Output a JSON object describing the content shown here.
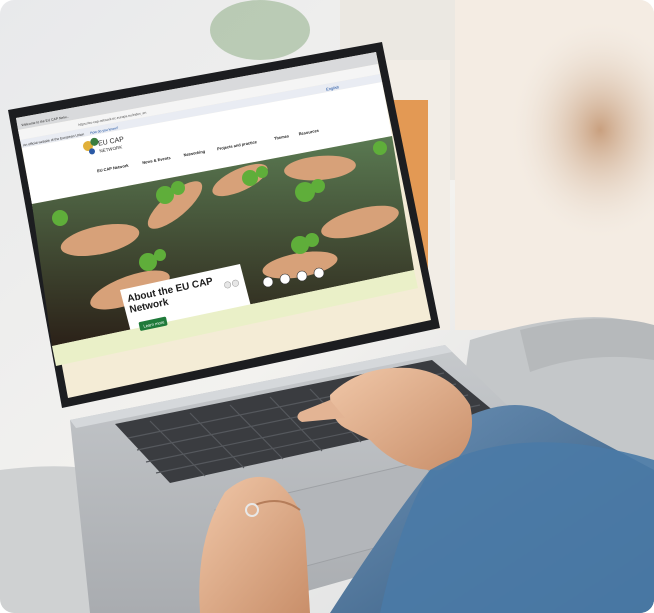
{
  "scene": {
    "subject": "person-typing-on-laptop",
    "setting": "living-room-sofa"
  },
  "browser": {
    "tab_title": "Welcome to the EU CAP Netw...",
    "url": "https://eu-cap-network.ec.europa.eu/index_en",
    "official_notice": "An official website of the European Union",
    "notice_link": "How do you know?",
    "language": "English"
  },
  "site": {
    "logo_text": [
      "EU CAP",
      "NETWORK"
    ],
    "nav": [
      "EU CAP Network",
      "News & Events",
      "Networking",
      "Projects and practice",
      "Themes",
      "Resources"
    ]
  },
  "hero": {
    "title_line1": "About the EU CAP",
    "title_line2": "Network",
    "button": "Learn more",
    "carousel_dots": 4
  },
  "colors": {
    "accent_green": "#1f7a3a",
    "page_beige": "#f4ecd6",
    "laptop_silver": "#b9bcc0",
    "denim": "#3f6f9a"
  }
}
